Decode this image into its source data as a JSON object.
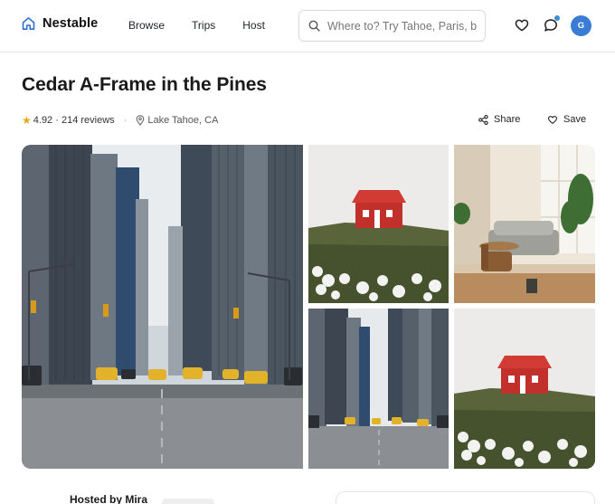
{
  "brand": {
    "name": "Nestable",
    "icon": "home-icon",
    "accent": "#2f6fd0"
  },
  "nav": [
    {
      "label": "Browse"
    },
    {
      "label": "Trips"
    },
    {
      "label": "Host"
    }
  ],
  "search": {
    "placeholder": "Where to? Try Tahoe, Paris, b",
    "value": ""
  },
  "header_icons": {
    "wishlist": "heart-icon",
    "messages": "chat-icon"
  },
  "user": {
    "initial": "G",
    "color": "#3a7bd5"
  },
  "listing": {
    "title": "Cedar A-Frame in the Pines",
    "rating": "4.92",
    "reviews": "214 reviews",
    "location": "Lake Tahoe, CA",
    "share_label": "Share",
    "save_label": "Save",
    "star_color": "#e7a817"
  },
  "photos": [
    {
      "subject": "city-street"
    },
    {
      "subject": "red-cabin"
    },
    {
      "subject": "living-room"
    },
    {
      "subject": "city-street"
    },
    {
      "subject": "red-cabin"
    }
  ],
  "host": {
    "heading": "Hosted by Mira"
  }
}
